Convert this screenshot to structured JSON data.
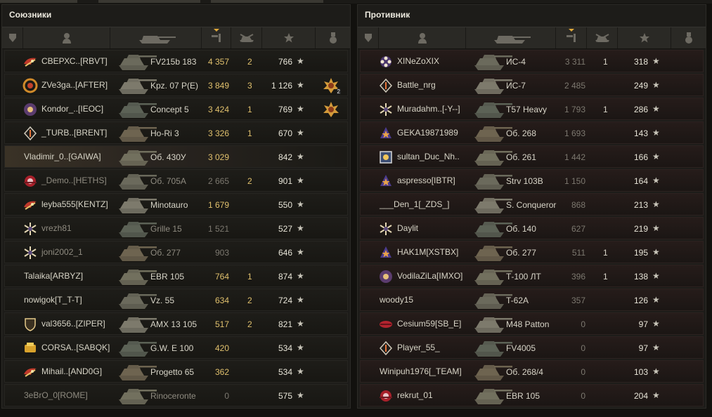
{
  "allies": {
    "title": "Союзники",
    "rows": [
      {
        "player": "СВЕРХС..[RBVT]",
        "tank": "FV215b 183",
        "damage": "4 357",
        "kills": "2",
        "xp": "766",
        "badge": "wings",
        "highlight": false,
        "dim": false,
        "damage_grey": false,
        "medal": null
      },
      {
        "player": "ZVe3ga..[AFTER]",
        "tank": "Kpz. 07 P(E)",
        "damage": "3 849",
        "kills": "3",
        "xp": "1 126",
        "badge": "laurel",
        "highlight": false,
        "dim": false,
        "damage_grey": false,
        "medal": {
          "count": "2"
        }
      },
      {
        "player": "Kondor_..[IEOC]",
        "tank": "Concept 5",
        "damage": "3 424",
        "kills": "1",
        "xp": "769",
        "badge": "eye",
        "highlight": false,
        "dim": false,
        "damage_grey": false,
        "medal": {
          "count": ""
        }
      },
      {
        "player": "_TURB..[BRENT]",
        "tank": "Ho-Ri 3",
        "damage": "3 326",
        "kills": "1",
        "xp": "670",
        "badge": "diamond",
        "highlight": false,
        "dim": false,
        "damage_grey": false,
        "medal": null
      },
      {
        "player": "Vladimir_0..[GAIWA]",
        "tank": "Об. 430У",
        "damage": "3 029",
        "kills": "",
        "xp": "842",
        "badge": "none",
        "highlight": true,
        "dim": false,
        "damage_grey": false,
        "medal": null
      },
      {
        "player": "_Demo..[HETHS]",
        "tank": "Об. 705А",
        "damage": "2 665",
        "kills": "2",
        "xp": "901",
        "badge": "red-disc",
        "highlight": false,
        "dim": true,
        "damage_grey": true,
        "medal": null
      },
      {
        "player": "leyba555[KENTZ]",
        "tank": "Minotauro",
        "damage": "1 679",
        "kills": "",
        "xp": "550",
        "badge": "wings",
        "highlight": false,
        "dim": false,
        "damage_grey": false,
        "medal": null
      },
      {
        "player": "vrezh81",
        "tank": "Grille 15",
        "damage": "1 521",
        "kills": "",
        "xp": "527",
        "badge": "snowflake",
        "highlight": false,
        "dim": true,
        "damage_grey": true,
        "medal": null
      },
      {
        "player": "joni2002_1",
        "tank": "Об. 277",
        "damage": "903",
        "kills": "",
        "xp": "646",
        "badge": "snowflake",
        "highlight": false,
        "dim": true,
        "damage_grey": true,
        "medal": null
      },
      {
        "player": "Talaika[ARBYZ]",
        "tank": "EBR 105",
        "damage": "764",
        "kills": "1",
        "xp": "874",
        "badge": "none",
        "highlight": false,
        "dim": false,
        "damage_grey": false,
        "medal": null
      },
      {
        "player": "nowigok[T_T-T]",
        "tank": "Vz. 55",
        "damage": "634",
        "kills": "2",
        "xp": "724",
        "badge": "none",
        "highlight": false,
        "dim": false,
        "damage_grey": false,
        "medal": null
      },
      {
        "player": "val3656..[ZIPER]",
        "tank": "AMX 13 105",
        "damage": "517",
        "kills": "2",
        "xp": "821",
        "badge": "shield",
        "highlight": false,
        "dim": false,
        "damage_grey": false,
        "medal": null
      },
      {
        "player": "CORSA..[SABQK]",
        "tank": "G.W. E 100",
        "damage": "420",
        "kills": "",
        "xp": "534",
        "badge": "gold",
        "highlight": false,
        "dim": false,
        "damage_grey": false,
        "medal": null
      },
      {
        "player": "Mihail..[AND0G]",
        "tank": "Progetto 65",
        "damage": "362",
        "kills": "",
        "xp": "534",
        "badge": "wings",
        "highlight": false,
        "dim": false,
        "damage_grey": false,
        "medal": null
      },
      {
        "player": "3eBrO_0[ROME]",
        "tank": "Rinoceronte",
        "damage": "0",
        "kills": "",
        "xp": "575",
        "badge": "none",
        "highlight": false,
        "dim": true,
        "damage_grey": true,
        "medal": null
      }
    ]
  },
  "enemies": {
    "title": "Противник",
    "rows": [
      {
        "player": "XINeZoXIX",
        "tank": "ИС-4",
        "damage": "3 311",
        "kills": "1",
        "xp": "318",
        "badge": "flower"
      },
      {
        "player": "Battle_nrg",
        "tank": "ИС-7",
        "damage": "2 485",
        "kills": "",
        "xp": "249",
        "badge": "diamond"
      },
      {
        "player": "Muradahm..[-Y--]",
        "tank": "T57 Heavy",
        "damage": "1 793",
        "kills": "1",
        "xp": "286",
        "badge": "snowflake"
      },
      {
        "player": "GEKA19871989",
        "tank": "Об. 268",
        "damage": "1 693",
        "kills": "",
        "xp": "143",
        "badge": "blue-star"
      },
      {
        "player": "sultan_Duc_Nh..",
        "tank": "Об. 261",
        "damage": "1 442",
        "kills": "",
        "xp": "166",
        "badge": "cube"
      },
      {
        "player": "aspresso[IBTR]",
        "tank": "Strv 103B",
        "damage": "1 150",
        "kills": "",
        "xp": "164",
        "badge": "blue-star"
      },
      {
        "player": "___Den_1[_ZDS_]",
        "tank": "S. Conqueror",
        "damage": "868",
        "kills": "",
        "xp": "213",
        "badge": "none"
      },
      {
        "player": "Daylit",
        "tank": "Об. 140",
        "damage": "627",
        "kills": "",
        "xp": "219",
        "badge": "snowflake"
      },
      {
        "player": "HAK1M[XSTBX]",
        "tank": "Об. 277",
        "damage": "511",
        "kills": "1",
        "xp": "195",
        "badge": "blue-star"
      },
      {
        "player": "VodilaZiLa[IMXO]",
        "tank": "Т-100 ЛТ",
        "damage": "396",
        "kills": "1",
        "xp": "138",
        "badge": "eye"
      },
      {
        "player": "woody15",
        "tank": "T-62A",
        "damage": "357",
        "kills": "",
        "xp": "126",
        "badge": "none"
      },
      {
        "player": "Cesium59[SB_E]",
        "tank": "M48 Patton",
        "damage": "0",
        "kills": "",
        "xp": "97",
        "badge": "red-lips"
      },
      {
        "player": "Player_55_",
        "tank": "FV4005",
        "damage": "0",
        "kills": "",
        "xp": "97",
        "badge": "diamond"
      },
      {
        "player": "Winipuh1976[_TEAM]",
        "tank": "Об. 268/4",
        "damage": "0",
        "kills": "",
        "xp": "103",
        "badge": "none"
      },
      {
        "player": "rekrut_01",
        "tank": "EBR 105",
        "damage": "0",
        "kills": "",
        "xp": "204",
        "badge": "red-disc"
      }
    ]
  },
  "header_icons": [
    "platoon-icon",
    "player-icon",
    "vehicle-icon",
    "damage-icon",
    "kills-icon",
    "xp-icon",
    "medal-icon"
  ],
  "colors": {
    "damage": "#e0c06d",
    "dim_damage": "#7c786f",
    "text": "#d8d5c8",
    "panel": "#1d1c19"
  }
}
